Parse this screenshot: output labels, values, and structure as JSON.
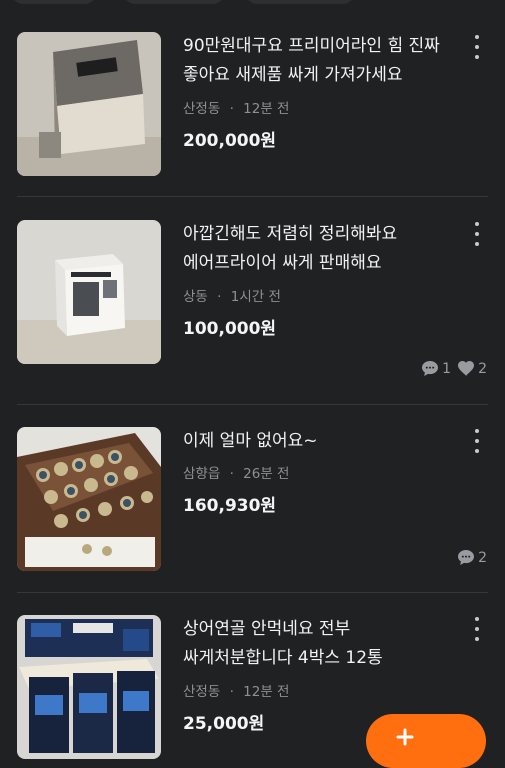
{
  "colors": {
    "background": "#202123",
    "accent": "#ff6f0f",
    "meta": "#8e8f94"
  },
  "listings": [
    {
      "title_line1": "90만원대구요 프리미어라인 힘 진짜",
      "title_line2": "좋아요 새제품 싸게 가져가세요",
      "location": "산정동",
      "time": "12분 전",
      "price": "200,000원",
      "chat_count": null,
      "like_count": null
    },
    {
      "title_line1": "아깝긴해도 저렴히 정리해봐요",
      "title_line2": "에어프라이어 싸게 판매해요",
      "location": "상동",
      "time": "1시간 전",
      "price": "100,000원",
      "chat_count": "1",
      "like_count": "2"
    },
    {
      "title_line1": "이제 얼마 없어요~",
      "title_line2": "",
      "location": "삼향읍",
      "time": "26분 전",
      "price": "160,930원",
      "chat_count": "2",
      "like_count": null
    },
    {
      "title_line1": "상어연골 안먹네요 전부",
      "title_line2": "싸게처분합니다 4박스 12통",
      "location": "산정동",
      "time": "12분 전",
      "price": "25,000원",
      "chat_count": null,
      "like_count": null
    }
  ],
  "meta_separator": "·",
  "icons": {
    "more": "more-vertical-icon",
    "chat": "chat-bubble-icon",
    "like": "heart-icon",
    "write": "plus-icon"
  }
}
